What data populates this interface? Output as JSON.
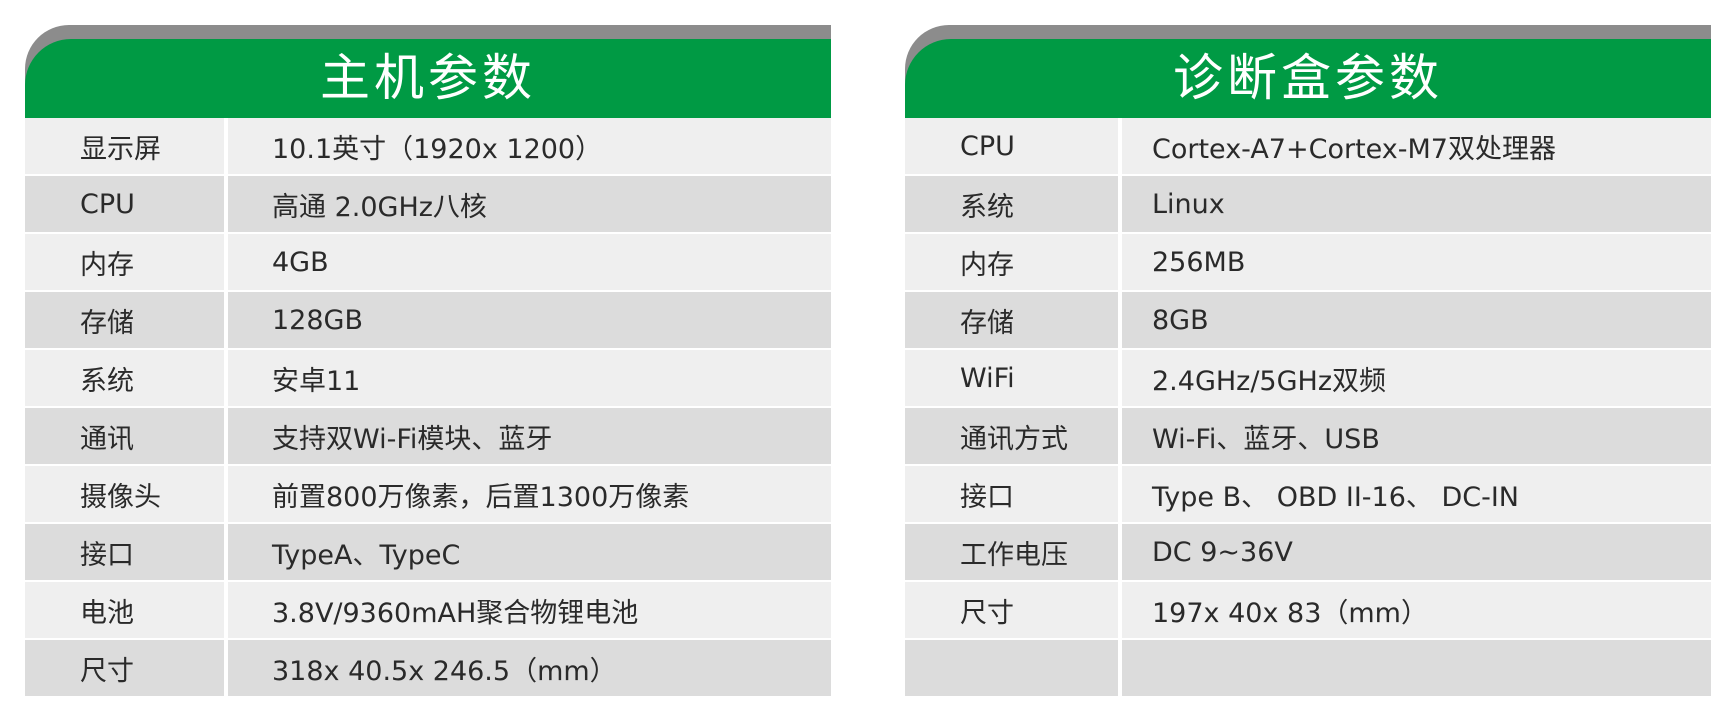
{
  "colors": {
    "header_green": "#009a44",
    "header_gray": "#8c8c8c",
    "row_light": "#efefef",
    "row_dark": "#dcdcdc",
    "text": "#2a2a2a"
  },
  "host": {
    "title": "主机参数",
    "rows": [
      {
        "label": "显示屏",
        "value": "10.1英寸（1920x 1200）"
      },
      {
        "label": "CPU",
        "value": "高通 2.0GHz八核"
      },
      {
        "label": "内存",
        "value": "4GB"
      },
      {
        "label": "存储",
        "value": "128GB"
      },
      {
        "label": "系统",
        "value": "安卓11"
      },
      {
        "label": "通讯",
        "value": "支持双Wi-Fi模块、蓝牙"
      },
      {
        "label": "摄像头",
        "value": "前置800万像素，后置1300万像素"
      },
      {
        "label": "接口",
        "value": "TypeA、TypeC"
      },
      {
        "label": "电池",
        "value": "3.8V/9360mAH聚合物锂电池"
      },
      {
        "label": "尺寸",
        "value": "318x 40.5x 246.5（mm）"
      }
    ]
  },
  "box": {
    "title": "诊断盒参数",
    "rows": [
      {
        "label": "CPU",
        "value": "Cortex-A7+Cortex-M7双处理器"
      },
      {
        "label": "系统",
        "value": "Linux"
      },
      {
        "label": "内存",
        "value": "256MB"
      },
      {
        "label": "存储",
        "value": "8GB"
      },
      {
        "label": "WiFi",
        "value": "2.4GHz/5GHz双频"
      },
      {
        "label": "通讯方式",
        "value": "Wi-Fi、蓝牙、USB"
      },
      {
        "label": "接口",
        "value": "Type B、 OBD II-16、 DC-IN"
      },
      {
        "label": "工作电压",
        "value": "DC 9~36V"
      },
      {
        "label": "尺寸",
        "value": "197x 40x 83（mm）"
      },
      {
        "label": "",
        "value": ""
      }
    ]
  }
}
